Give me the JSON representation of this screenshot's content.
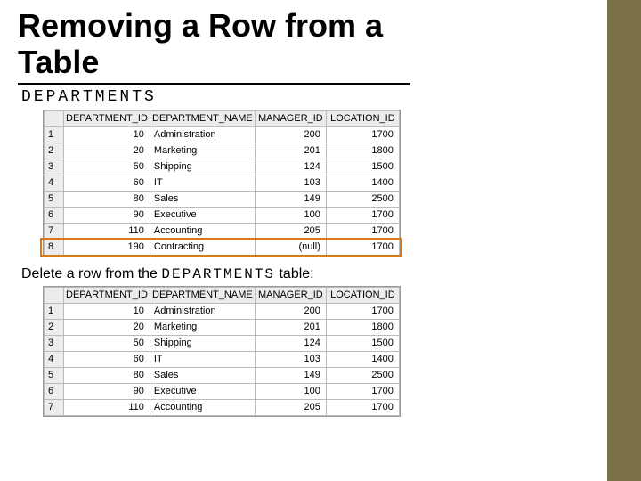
{
  "title": "Removing a Row from a Table",
  "subtitle": "DEPARTMENTS",
  "caption_prefix": "Delete a row from the ",
  "caption_mono": "DEPARTMENTS",
  "caption_suffix": " table:",
  "headers": {
    "dept_id": "DEPARTMENT_ID",
    "dept_name": "DEPARTMENT_NAME",
    "mgr_id": "MANAGER_ID",
    "loc_id": "LOCATION_ID"
  },
  "table1": [
    {
      "n": "1",
      "id": "10",
      "name": "Administration",
      "mgr": "200",
      "loc": "1700"
    },
    {
      "n": "2",
      "id": "20",
      "name": "Marketing",
      "mgr": "201",
      "loc": "1800"
    },
    {
      "n": "3",
      "id": "50",
      "name": "Shipping",
      "mgr": "124",
      "loc": "1500"
    },
    {
      "n": "4",
      "id": "60",
      "name": "IT",
      "mgr": "103",
      "loc": "1400"
    },
    {
      "n": "5",
      "id": "80",
      "name": "Sales",
      "mgr": "149",
      "loc": "2500"
    },
    {
      "n": "6",
      "id": "90",
      "name": "Executive",
      "mgr": "100",
      "loc": "1700"
    },
    {
      "n": "7",
      "id": "110",
      "name": "Accounting",
      "mgr": "205",
      "loc": "1700"
    },
    {
      "n": "8",
      "id": "190",
      "name": "Contracting",
      "mgr": "(null)",
      "loc": "1700"
    }
  ],
  "table2": [
    {
      "n": "1",
      "id": "10",
      "name": "Administration",
      "mgr": "200",
      "loc": "1700"
    },
    {
      "n": "2",
      "id": "20",
      "name": "Marketing",
      "mgr": "201",
      "loc": "1800"
    },
    {
      "n": "3",
      "id": "50",
      "name": "Shipping",
      "mgr": "124",
      "loc": "1500"
    },
    {
      "n": "4",
      "id": "60",
      "name": "IT",
      "mgr": "103",
      "loc": "1400"
    },
    {
      "n": "5",
      "id": "80",
      "name": "Sales",
      "mgr": "149",
      "loc": "2500"
    },
    {
      "n": "6",
      "id": "90",
      "name": "Executive",
      "mgr": "100",
      "loc": "1700"
    },
    {
      "n": "7",
      "id": "110",
      "name": "Accounting",
      "mgr": "205",
      "loc": "1700"
    }
  ]
}
